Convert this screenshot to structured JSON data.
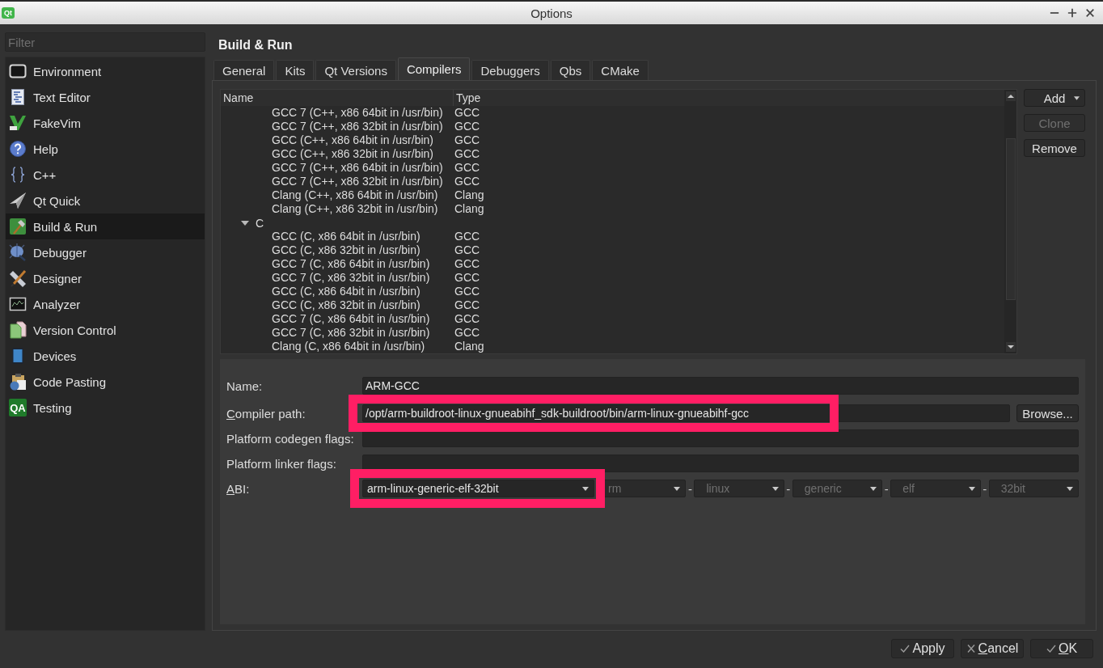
{
  "window": {
    "title": "Options",
    "logo": "Qt"
  },
  "sidebar": {
    "filter": {
      "placeholder": "Filter"
    },
    "items": [
      {
        "label": "Environment",
        "kind": "environment",
        "selected": false
      },
      {
        "label": "Text Editor",
        "kind": "editor",
        "selected": false
      },
      {
        "label": "FakeVim",
        "kind": "fakevim",
        "selected": false
      },
      {
        "label": "Help",
        "kind": "help",
        "selected": false
      },
      {
        "label": "C++",
        "kind": "cpp",
        "selected": false
      },
      {
        "label": "Qt Quick",
        "kind": "quick",
        "selected": false
      },
      {
        "label": "Build & Run",
        "kind": "build",
        "selected": true
      },
      {
        "label": "Debugger",
        "kind": "debugger",
        "selected": false
      },
      {
        "label": "Designer",
        "kind": "designer",
        "selected": false
      },
      {
        "label": "Analyzer",
        "kind": "analyzer",
        "selected": false
      },
      {
        "label": "Version Control",
        "kind": "vcs",
        "selected": false
      },
      {
        "label": "Devices",
        "kind": "devices",
        "selected": false
      },
      {
        "label": "Code Pasting",
        "kind": "pasting",
        "selected": false
      },
      {
        "label": "Testing",
        "kind": "testing",
        "selected": false,
        "icon_text": "QA"
      }
    ]
  },
  "page": {
    "title": "Build & Run",
    "tabs": [
      {
        "label": "General",
        "selected": false
      },
      {
        "label": "Kits",
        "selected": false
      },
      {
        "label": "Qt Versions",
        "selected": false
      },
      {
        "label": "Compilers",
        "selected": true
      },
      {
        "label": "Debuggers",
        "selected": false
      },
      {
        "label": "Qbs",
        "selected": false
      },
      {
        "label": "CMake",
        "selected": false
      }
    ],
    "compilers": {
      "columns": [
        "Name",
        "Type"
      ],
      "rows": [
        {
          "children": [
            {
              "name": "GCC 7 (C++, x86 64bit in /usr/bin)",
              "type": "GCC",
              "selected": false
            },
            {
              "name": "GCC 7 (C++, x86 32bit in /usr/bin)",
              "type": "GCC",
              "selected": false
            },
            {
              "name": "GCC (C++, x86 64bit in /usr/bin)",
              "type": "GCC",
              "selected": false
            },
            {
              "name": "GCC (C++, x86 32bit in /usr/bin)",
              "type": "GCC",
              "selected": false
            },
            {
              "name": "GCC 7 (C++, x86 64bit in /usr/bin)",
              "type": "GCC",
              "selected": false
            },
            {
              "name": "GCC 7 (C++, x86 32bit in /usr/bin)",
              "type": "GCC",
              "selected": false
            },
            {
              "name": "Clang (C++, x86 64bit in /usr/bin)",
              "type": "Clang",
              "selected": false
            },
            {
              "name": "Clang (C++, x86 32bit in /usr/bin)",
              "type": "Clang",
              "selected": false
            }
          ]
        },
        {
          "label": "C",
          "expanded": true,
          "children": [
            {
              "name": "GCC (C, x86 64bit in /usr/bin)",
              "type": "GCC",
              "selected": false
            },
            {
              "name": "GCC (C, x86 32bit in /usr/bin)",
              "type": "GCC",
              "selected": false
            },
            {
              "name": "GCC 7 (C, x86 64bit in /usr/bin)",
              "type": "GCC",
              "selected": false
            },
            {
              "name": "GCC 7 (C, x86 32bit in /usr/bin)",
              "type": "GCC",
              "selected": false
            },
            {
              "name": "GCC (C, x86 64bit in /usr/bin)",
              "type": "GCC",
              "selected": false
            },
            {
              "name": "GCC (C, x86 32bit in /usr/bin)",
              "type": "GCC",
              "selected": false
            },
            {
              "name": "GCC 7 (C, x86 64bit in /usr/bin)",
              "type": "GCC",
              "selected": false
            },
            {
              "name": "GCC 7 (C, x86 32bit in /usr/bin)",
              "type": "GCC",
              "selected": false
            },
            {
              "name": "Clang (C, x86 64bit in /usr/bin)",
              "type": "Clang",
              "selected": false
            }
          ]
        }
      ]
    },
    "buttons": [
      {
        "label": "Add",
        "kind": "menu",
        "disabled": false
      },
      {
        "label": "Clone",
        "kind": "plain",
        "disabled": true
      },
      {
        "label": "Remove",
        "kind": "plain",
        "disabled": false
      }
    ],
    "details": {
      "fields": [
        {
          "kind": "text",
          "label": "Name:",
          "mnemonic": false,
          "value": "ARM-GCC",
          "highlighted": false
        },
        {
          "kind": "path",
          "label": "Compiler path:",
          "mnemonic": true,
          "value": "/opt/arm-buildroot-linux-gnueabihf_sdk-buildroot/bin/arm-linux-gnueabihf-gcc",
          "browse": "Browse...",
          "highlighted": true
        },
        {
          "kind": "text",
          "label": "Platform codegen flags:",
          "mnemonic": false,
          "highlighted": false
        },
        {
          "kind": "text",
          "label": "Platform linker flags:",
          "mnemonic": false,
          "highlighted": false
        },
        {
          "kind": "abi",
          "label": "ABI:",
          "mnemonic": true,
          "value": "arm-linux-generic-elf-32bit",
          "highlighted": true,
          "parts": [
            {
              "kind": "combo",
              "value": "rm",
              "disabled": true
            },
            {
              "kind": "separator",
              "value": "-"
            },
            {
              "kind": "combo",
              "value": "linux",
              "disabled": true
            },
            {
              "kind": "separator",
              "value": "-"
            },
            {
              "kind": "combo",
              "value": "generic",
              "disabled": true
            },
            {
              "kind": "separator",
              "value": "-"
            },
            {
              "kind": "combo",
              "value": "elf",
              "disabled": true
            },
            {
              "kind": "separator",
              "value": "-"
            },
            {
              "kind": "combo",
              "value": "32bit",
              "disabled": true
            }
          ]
        }
      ]
    }
  },
  "footer": {
    "buttons": [
      {
        "label": "Apply",
        "kind": "confirm",
        "mnemonic": false
      },
      {
        "label": "Cancel",
        "kind": "cancel",
        "mnemonic": true
      },
      {
        "label": "OK",
        "kind": "confirm",
        "mnemonic": true
      }
    ]
  }
}
